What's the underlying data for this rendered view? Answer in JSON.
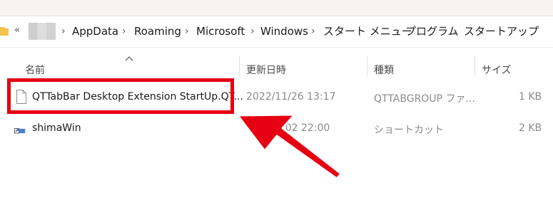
{
  "breadcrumb": {
    "collapse": "«",
    "items": [
      "AppData",
      "Roaming",
      "Microsoft",
      "Windows",
      "スタート メニュー",
      "プログラム",
      "スタートアップ"
    ],
    "separator": "›"
  },
  "columns": {
    "name": "名前",
    "date": "更新日時",
    "type": "種類",
    "size": "サイズ"
  },
  "files": [
    {
      "name": "QTTabBar Desktop Extension StartUp.QT...",
      "date": "2022/11/26 13:17",
      "type": "QTTABGROUP ファ...",
      "size": "1 KB",
      "icon": "file-icon"
    },
    {
      "name": "shimaWin",
      "date": "/02 22:00",
      "type": "ショートカット",
      "size": "2 KB",
      "icon": "shortcut-icon"
    }
  ],
  "colors": {
    "highlight": "#e60012",
    "arrow": "#e60012"
  }
}
